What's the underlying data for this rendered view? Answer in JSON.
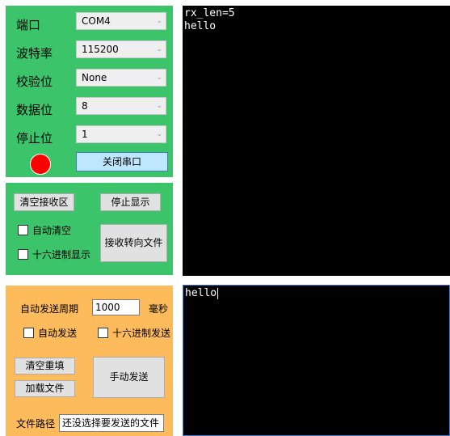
{
  "serial": {
    "port_label": "端口",
    "port_value": "COM4",
    "baud_label": "波特率",
    "baud_value": "115200",
    "parity_label": "校验位",
    "parity_value": "None",
    "databits_label": "数据位",
    "databits_value": "8",
    "stopbits_label": "停止位",
    "stopbits_value": "1",
    "status_color": "#ff0000",
    "toggle_label": "关闭串口"
  },
  "receive": {
    "clear_label": "清空接收区",
    "stop_display_label": "停止显示",
    "auto_clear_label": "自动清空",
    "hex_display_label": "十六进制显示",
    "to_file_label": "接收转向文件",
    "terminal_text": "rx_len=5\nhello"
  },
  "send": {
    "period_label": "自动发送周期",
    "period_value": "1000",
    "period_unit": "毫秒",
    "auto_send_label": "自动发送",
    "hex_send_label": "十六进制发送",
    "clear_refill_label": "清空重填",
    "load_file_label": "加载文件",
    "manual_send_label": "手动发送",
    "file_path_label": "文件路径",
    "file_path_value": "还没选择要发送的文件",
    "terminal_text": "hello"
  },
  "colors": {
    "serial_panel": "#3cc46a",
    "send_panel": "#fdbb5c",
    "terminal_bg": "#000000"
  },
  "icons": [
    "dropdown-arrow-icon",
    "status-led-icon"
  ]
}
